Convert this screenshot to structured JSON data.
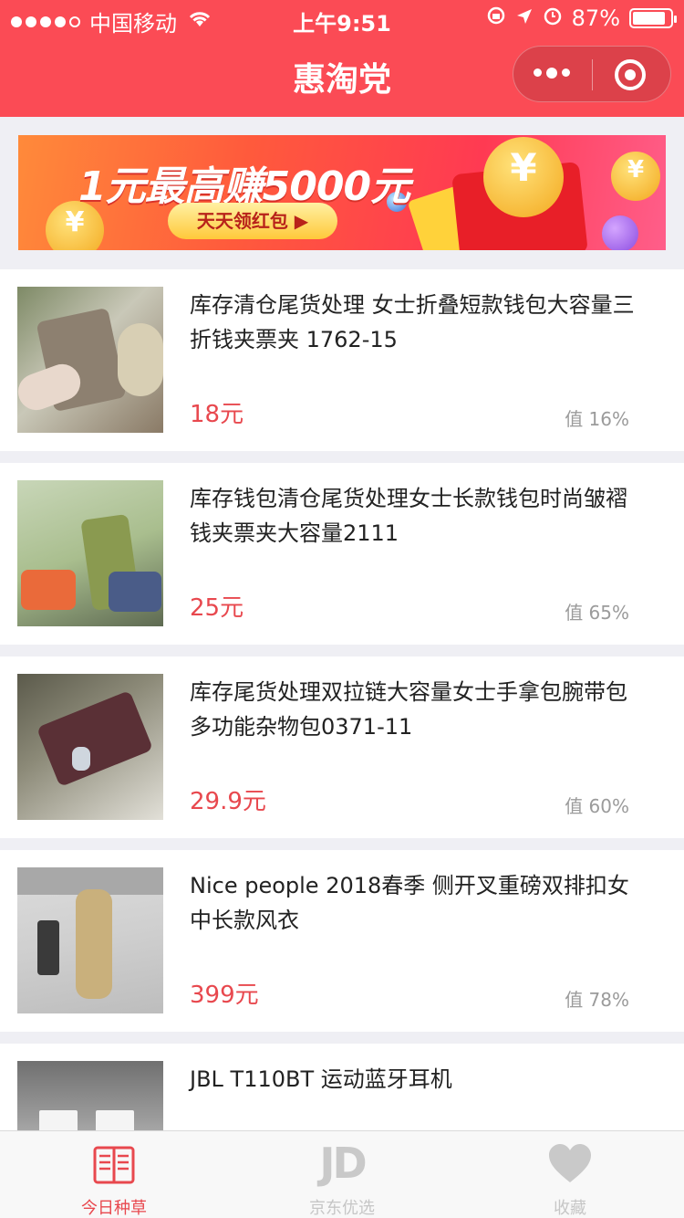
{
  "status_bar": {
    "carrier": "中国移动",
    "time": "上午9:51",
    "battery": "87%",
    "battery_level": 0.87
  },
  "nav": {
    "title": "惠淘党"
  },
  "banner": {
    "headline": "1元最高赚5000元",
    "button": "天天领红包 ▶"
  },
  "items": [
    {
      "title": "库存清仓尾货处理 女士折叠短款钱包大容量三折钱夹票夹 1762-15",
      "price": "18元",
      "score": "值 16%"
    },
    {
      "title": "库存钱包清仓尾货处理女士长款钱包时尚皱褶钱夹票夹大容量2111",
      "price": "25元",
      "score": "值 65%"
    },
    {
      "title": "库存尾货处理双拉链大容量女士手拿包腕带包多功能杂物包0371-11",
      "price": "29.9元",
      "score": "值 60%"
    },
    {
      "title": "Nice people 2018春季 侧开叉重磅双排扣女中长款风衣",
      "price": "399元",
      "score": "值 78%"
    },
    {
      "title": "JBL T110BT 运动蓝牙耳机",
      "price": "",
      "score": ""
    }
  ],
  "tabs": [
    {
      "label": "今日种草",
      "icon": "book-icon",
      "active": true
    },
    {
      "label": "京东优选",
      "icon": "jd-icon",
      "icon_text": "JD",
      "active": false
    },
    {
      "label": "收藏",
      "icon": "heart-icon",
      "active": false
    }
  ],
  "colors": {
    "brand": "#fb4b55",
    "price": "#e8484e",
    "score": "#9b9b9b",
    "tab_inactive": "#c6c6c6"
  }
}
